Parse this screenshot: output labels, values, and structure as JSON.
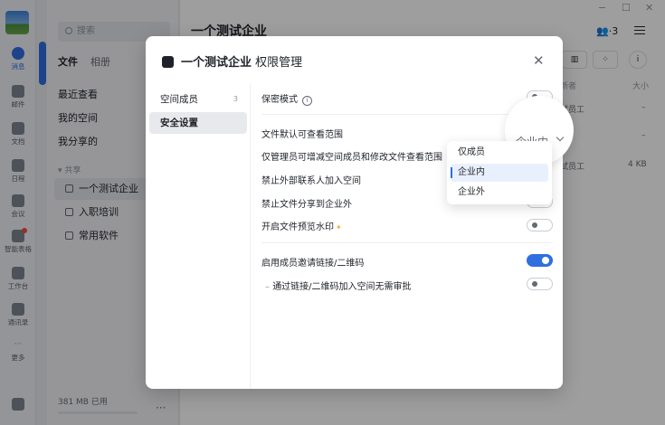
{
  "rail": {
    "items": [
      {
        "label": "消息"
      },
      {
        "label": "邮件"
      },
      {
        "label": "文档"
      },
      {
        "label": "日程"
      },
      {
        "label": "会议"
      },
      {
        "label": "智能表格"
      },
      {
        "label": "工作台"
      },
      {
        "label": "通讯录"
      },
      {
        "label": "更多"
      }
    ]
  },
  "files": {
    "search_placeholder": "搜索",
    "tabs": [
      "文件",
      "相册"
    ],
    "nav": [
      "最近查看",
      "我的空间",
      "我分享的"
    ],
    "group_label": "▾ 共享",
    "spaces": [
      "一个测试企业",
      "入职培训",
      "常用软件"
    ],
    "storage": "381 MB 已用",
    "more": "···"
  },
  "main": {
    "title": "一个测试企业",
    "members": "3",
    "win_min": "−",
    "win_max": "☐",
    "win_close": "✕",
    "col_updater": "新者",
    "col_size": "大小",
    "rows": [
      {
        "updater": "试员工",
        "size": "–"
      },
      {
        "updater": "工",
        "size": "–"
      },
      {
        "updater": "试员工",
        "size": "4 KB"
      }
    ]
  },
  "dialog": {
    "space_name": "一个测试企业",
    "title_suffix": "权限管理",
    "close": "✕",
    "sidebar": [
      {
        "label": "空间成员",
        "count": "3"
      },
      {
        "label": "安全设置"
      }
    ],
    "settings": {
      "confidential": "保密模式",
      "default_scope": "文件默认可查看范围",
      "admin_only": "仅管理员可增减空间成员和修改文件查看范围",
      "no_external": "禁止外部联系人加入空间",
      "no_share_out": "禁止文件分享到企业外",
      "watermark": "开启文件预览水印",
      "invite_link": "启用成员邀请链接/二维码",
      "no_approval": "通过链接/二维码加入空间无需审批"
    },
    "toggles": {
      "confidential": false,
      "admin_only": false,
      "no_external": false,
      "no_share_out": false,
      "watermark": false,
      "invite_link": true,
      "no_approval": false
    },
    "scope_value": "企业内",
    "scope_options": [
      "仅成员",
      "企业内",
      "企业外"
    ]
  }
}
